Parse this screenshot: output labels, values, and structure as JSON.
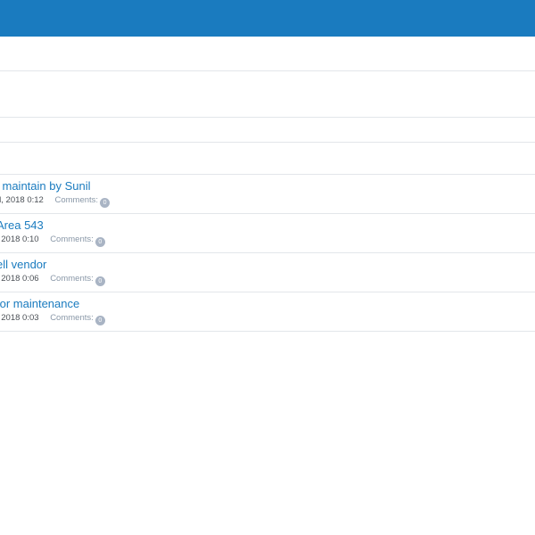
{
  "header": {
    "accent_color": "#1a7bbf"
  },
  "posts": [
    {
      "title": "l maintain by Sunil",
      "date": "d, 2018 0:12",
      "comments_label": "Comments:",
      "comments_count": "0"
    },
    {
      "title": "Area 543",
      "date": ", 2018 0:10",
      "comments_label": "Comments:",
      "comments_count": "0"
    },
    {
      "title": "ell vendor",
      "date": ". 2018 0:06",
      "comments_label": "Comments:",
      "comments_count": "0"
    },
    {
      "title": "for maintenance",
      "date": ", 2018 0:03",
      "comments_label": "Comments:",
      "comments_count": "0"
    }
  ]
}
